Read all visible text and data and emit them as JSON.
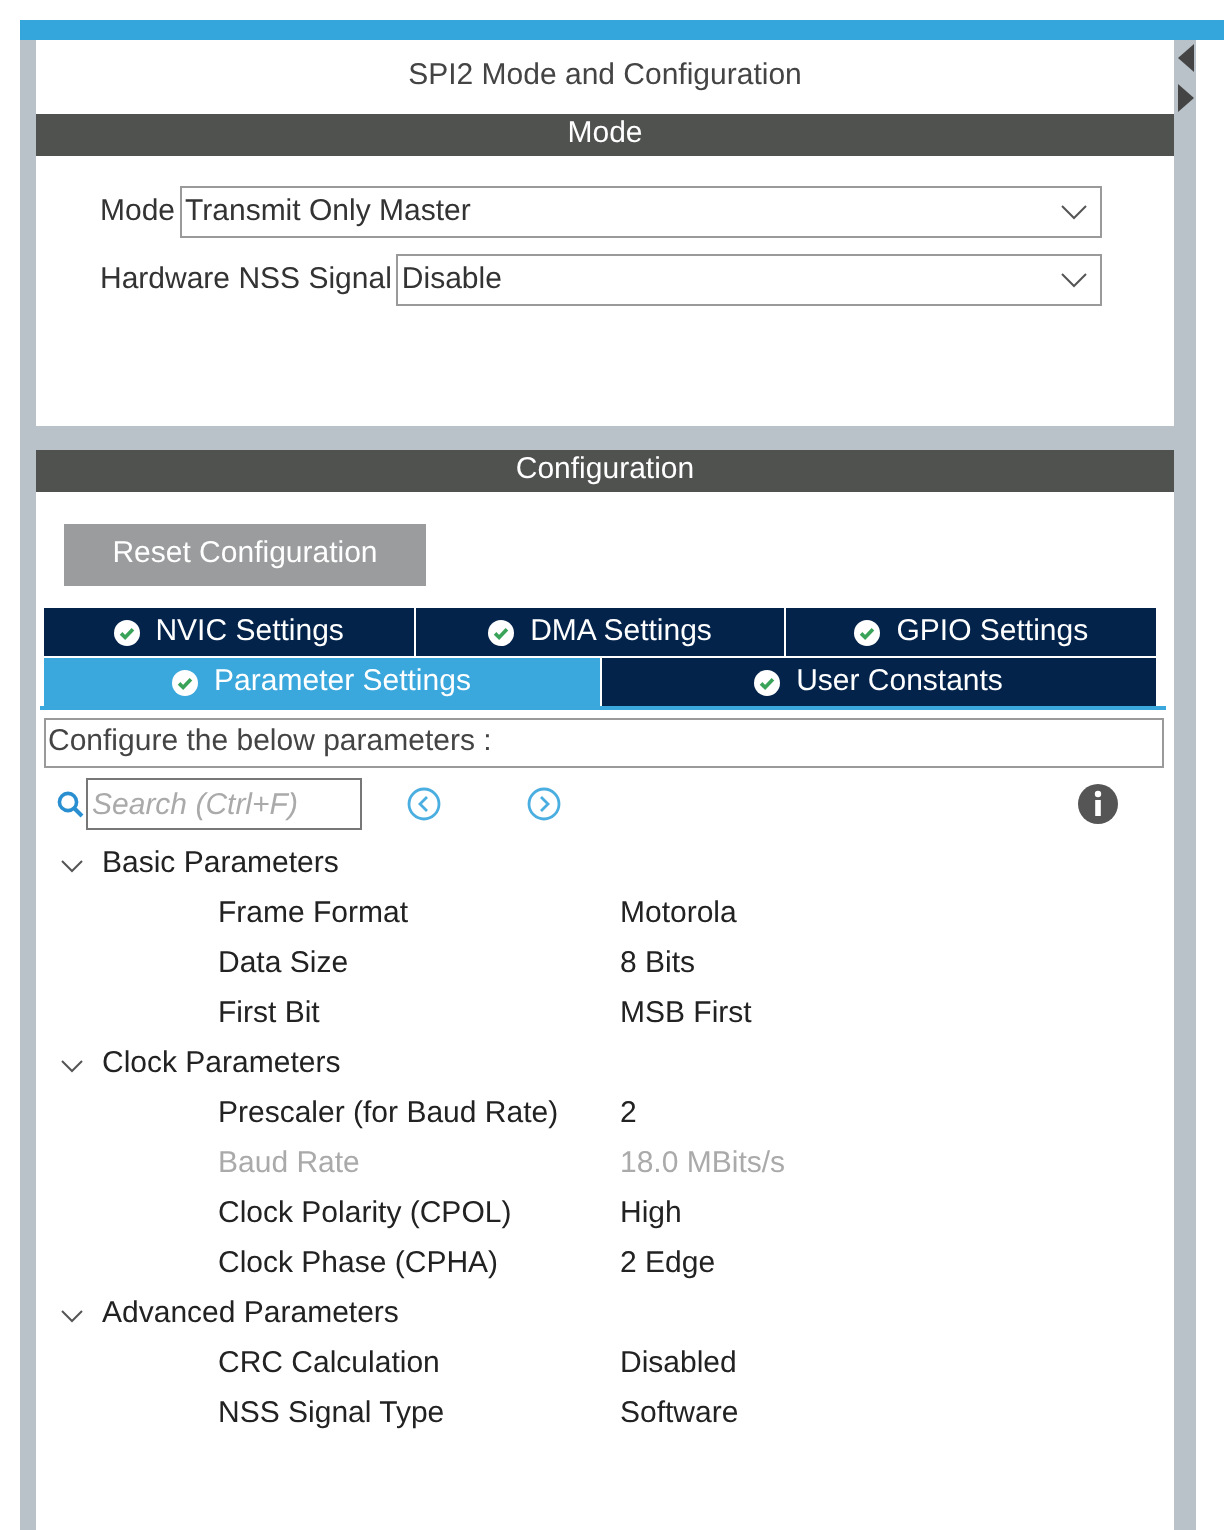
{
  "title": "SPI2 Mode and Configuration",
  "mode_section": {
    "header": "Mode",
    "fields": [
      {
        "label": "Mode",
        "value": "Transmit Only Master"
      },
      {
        "label": "Hardware NSS Signal",
        "value": "Disable"
      }
    ]
  },
  "configuration": {
    "header": "Configuration",
    "reset_button": "Reset Configuration",
    "tab_rows": [
      [
        {
          "label": "NVIC Settings",
          "selected": false
        },
        {
          "label": "DMA Settings",
          "selected": false
        },
        {
          "label": "GPIO Settings",
          "selected": false
        }
      ],
      [
        {
          "label": "Parameter Settings",
          "selected": true
        },
        {
          "label": "User Constants",
          "selected": false
        }
      ]
    ],
    "hint": "Configure the below parameters :",
    "search": {
      "placeholder": "Search (Ctrl+F)"
    },
    "groups": [
      {
        "label": "Basic Parameters",
        "expanded": true,
        "children": [
          {
            "name": "Frame Format",
            "value": "Motorola",
            "disabled": false
          },
          {
            "name": "Data Size",
            "value": "8 Bits",
            "disabled": false
          },
          {
            "name": "First Bit",
            "value": "MSB First",
            "disabled": false
          }
        ]
      },
      {
        "label": "Clock Parameters",
        "expanded": true,
        "children": [
          {
            "name": "Prescaler (for Baud Rate)",
            "value": "2",
            "disabled": false
          },
          {
            "name": "Baud Rate",
            "value": "18.0 MBits/s",
            "disabled": true
          },
          {
            "name": "Clock Polarity (CPOL)",
            "value": "High",
            "disabled": false
          },
          {
            "name": "Clock Phase (CPHA)",
            "value": "2 Edge",
            "disabled": false
          }
        ]
      },
      {
        "label": "Advanced Parameters",
        "expanded": true,
        "children": [
          {
            "name": "CRC Calculation",
            "value": "Disabled",
            "disabled": false
          },
          {
            "name": "NSS Signal Type",
            "value": "Software",
            "disabled": false
          }
        ]
      }
    ]
  }
}
